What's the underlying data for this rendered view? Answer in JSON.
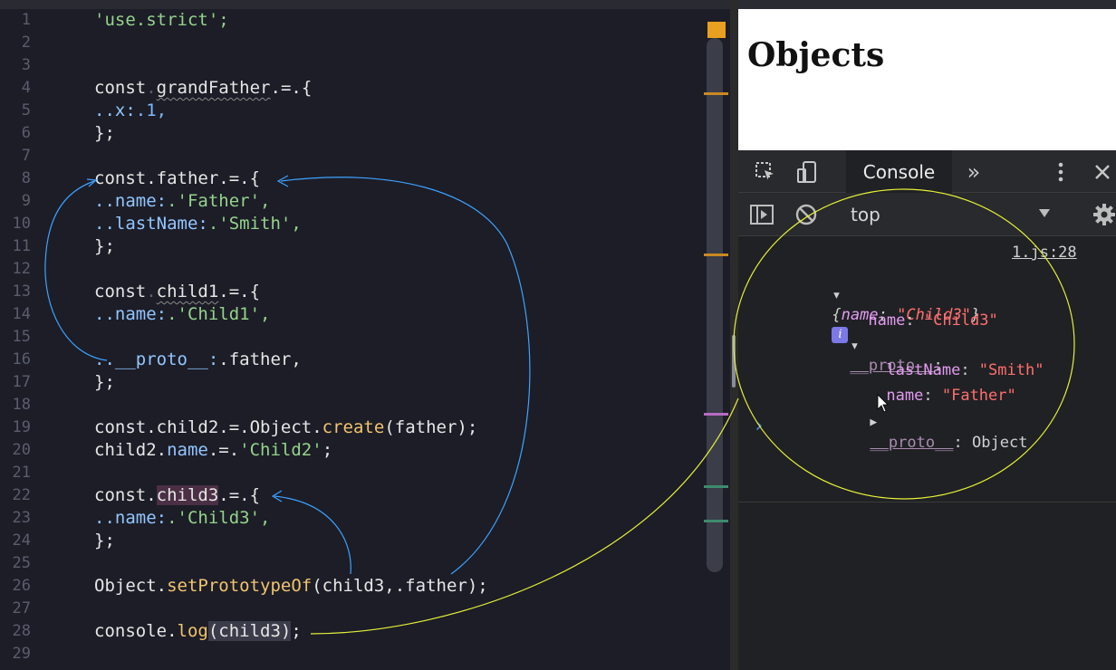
{
  "editor": {
    "line_numbers": [
      "1",
      "2",
      "3",
      "4",
      "5",
      "6",
      "7",
      "8",
      "9",
      "10",
      "11",
      "12",
      "13",
      "14",
      "15",
      "16",
      "17",
      "18",
      "19",
      "20",
      "21",
      "22",
      "23",
      "24",
      "25",
      "26",
      "27",
      "28",
      "29"
    ],
    "lines": {
      "l1": "'use.strict';",
      "l4_kw": "const",
      "l4_name": "grandFather",
      "l4_rest": ".=.{",
      "l5_prop": "..x:",
      "l5_val": ".1,",
      "l6": "};",
      "l8": "const.father.=.{",
      "l9_prop": "..name:",
      "l9_val": ".'Father',",
      "l10_prop": "..lastName:",
      "l10_val": ".'Smith',",
      "l11": "};",
      "l13_kw": "const",
      "l13_name": "child1",
      "l13_rest": ".=.{",
      "l14_prop": "..name:",
      "l14_val": ".'Child1',",
      "l16_prop": "..__proto__:",
      "l16_val": ".father,",
      "l17": "};",
      "l19_a": "const.child2.=.Object.",
      "l19_fn": "create",
      "l19_b": "(father);",
      "l20_a": "child2.",
      "l20_prop": "name",
      "l20_b": ".=.",
      "l20_str": "'Child2'",
      "l20_c": ";",
      "l22_kw": "const.",
      "l22_name": "child3",
      "l22_rest": ".=.{",
      "l23_prop": "..name:",
      "l23_val": ".'Child3',",
      "l24": "};",
      "l26_a": "Object.",
      "l26_fn": "setPrototypeOf",
      "l26_b": "(child3,.father);",
      "l28_a": "console.",
      "l28_fn": "log",
      "l28_b": "(child3)",
      "l28_c": ";"
    }
  },
  "browser": {
    "page_heading": "Objects"
  },
  "devtools": {
    "tabs": {
      "console": "Console",
      "more": "»"
    },
    "context": "top",
    "source_link": "1.js:28",
    "log": {
      "summary_open": "{",
      "summary_key": "name",
      "summary_colon": ": ",
      "summary_val": "\"Child3\"",
      "summary_close": "}",
      "info": "i",
      "name_key": "name",
      "name_val": "\"Child3\"",
      "proto_key": "__proto__",
      "colon": ":",
      "lastname_key": "lastName",
      "lastname_val": "\"Smith\"",
      "father_name_key": "name",
      "father_name_val": "\"Father\"",
      "proto2_key": "__proto__",
      "proto2_val": ": Object"
    },
    "prompt": "›"
  },
  "colors": {
    "editor_bg": "#1c1d27",
    "string": "#95d38b",
    "function": "#f2c46d",
    "annotation_blue": "#3fa2ff",
    "annotation_yellow": "#e6f03a"
  }
}
